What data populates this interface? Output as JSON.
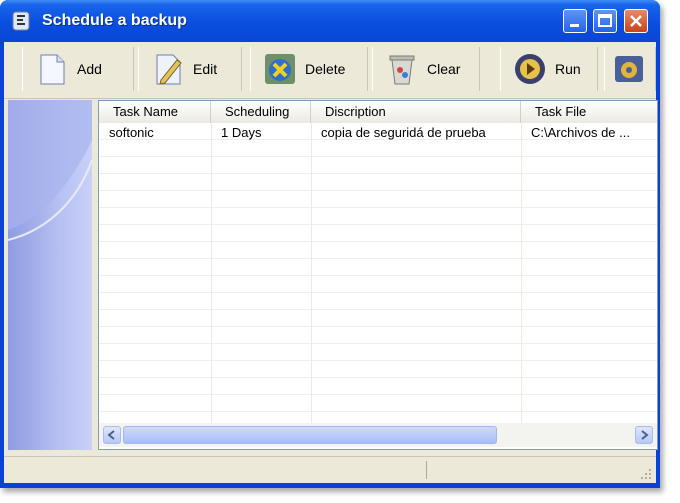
{
  "window": {
    "title": "Schedule a backup"
  },
  "toolbar": {
    "buttons": [
      {
        "label": "Add",
        "icon": "add-icon"
      },
      {
        "label": "Edit",
        "icon": "edit-icon"
      },
      {
        "label": "Delete",
        "icon": "delete-icon"
      },
      {
        "label": "Clear",
        "icon": "clear-icon"
      },
      {
        "label": "Run",
        "icon": "run-icon"
      },
      {
        "label": "",
        "icon": "settings-icon"
      }
    ]
  },
  "table": {
    "columns": [
      "Task Name",
      "Scheduling",
      "Discription",
      "Task File"
    ],
    "rows": [
      [
        "softonic",
        "1 Days",
        "copia de seguridá de prueba",
        "C:\\Archivos de ..."
      ]
    ]
  },
  "colors": {
    "titlebar": "#0a4ee0",
    "panel": "#ece9d8",
    "accent": "#2664e6"
  }
}
